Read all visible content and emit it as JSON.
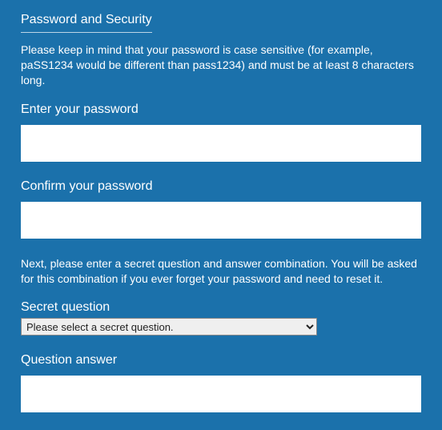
{
  "section": {
    "title": "Password and Security",
    "password_hint": "Please keep in mind that your password is case sensitive (for example, paSS1234 would be different than pass1234) and must be at least 8 characters long.",
    "enter_password_label": "Enter your password",
    "enter_password_value": "",
    "confirm_password_label": "Confirm your password",
    "confirm_password_value": "",
    "question_hint": "Next, please enter a secret question and answer combination. You will be asked for this combination if you ever forget your password and need to reset it.",
    "secret_question_label": "Secret question",
    "secret_question_selected": "Please select a secret question.",
    "question_answer_label": "Question answer",
    "question_answer_value": ""
  }
}
